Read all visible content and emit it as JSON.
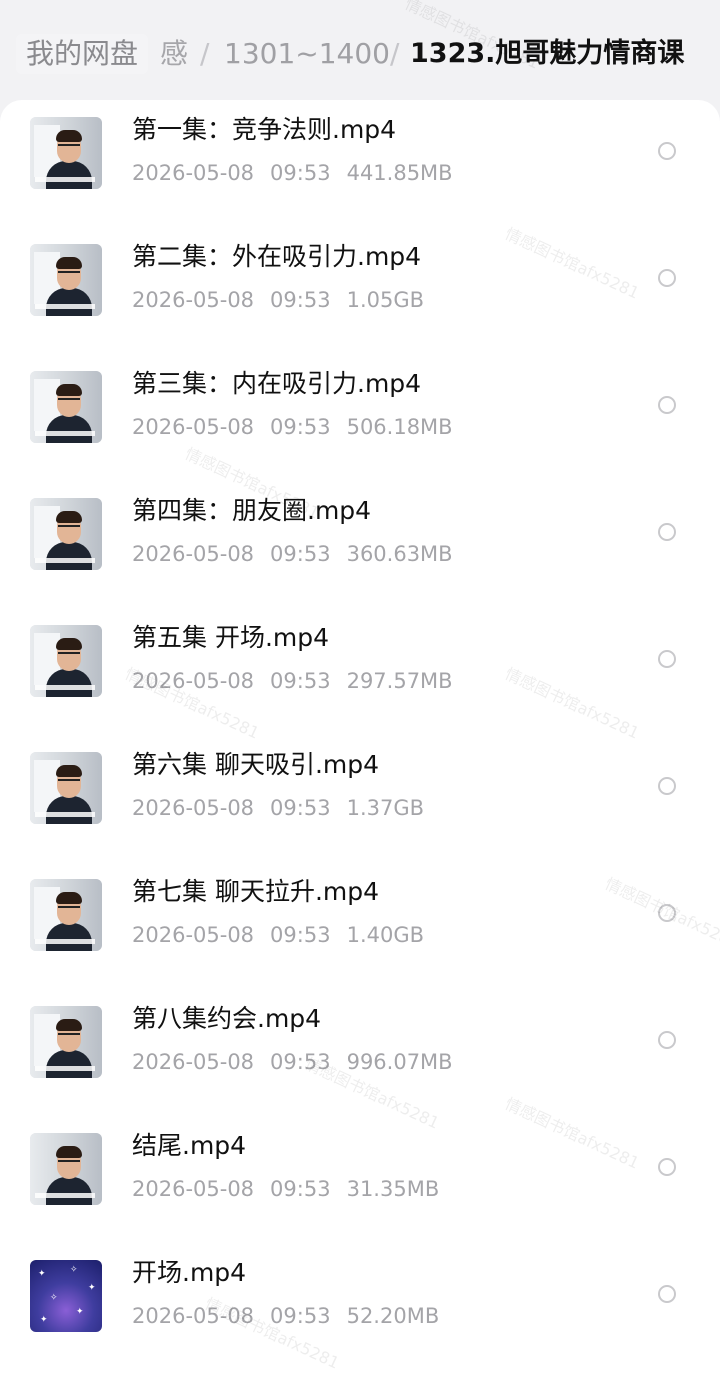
{
  "breadcrumb": {
    "root": "我的网盘",
    "mid_fragment": "感",
    "sep": "/",
    "folder": "1301~1400",
    "current": "1323.旭哥魅力情商课"
  },
  "files": [
    {
      "name": "第一集：竞争法则.mp4",
      "date": "2026-05-08",
      "time": "09:53",
      "size": "441.85MB",
      "thumb": "video-thumbnail"
    },
    {
      "name": "第二集：外在吸引力.mp4",
      "date": "2026-05-08",
      "time": "09:53",
      "size": "1.05GB",
      "thumb": "video-thumbnail"
    },
    {
      "name": "第三集：内在吸引力.mp4",
      "date": "2026-05-08",
      "time": "09:53",
      "size": "506.18MB",
      "thumb": "video-thumbnail"
    },
    {
      "name": "第四集：朋友圈.mp4",
      "date": "2026-05-08",
      "time": "09:53",
      "size": "360.63MB",
      "thumb": "video-thumbnail"
    },
    {
      "name": "第五集 开场.mp4",
      "date": "2026-05-08",
      "time": "09:53",
      "size": "297.57MB",
      "thumb": "video-thumbnail"
    },
    {
      "name": "第六集 聊天吸引.mp4",
      "date": "2026-05-08",
      "time": "09:53",
      "size": "1.37GB",
      "thumb": "video-thumbnail"
    },
    {
      "name": "第七集 聊天拉升.mp4",
      "date": "2026-05-08",
      "time": "09:53",
      "size": "1.40GB",
      "thumb": "video-thumbnail"
    },
    {
      "name": "第八集约会.mp4",
      "date": "2026-05-08",
      "time": "09:53",
      "size": "996.07MB",
      "thumb": "video-thumbnail"
    },
    {
      "name": "结尾.mp4",
      "date": "2026-05-08",
      "time": "09:53",
      "size": "31.35MB",
      "thumb": "video-thumbnail"
    },
    {
      "name": "开场.mp4",
      "date": "2026-05-08",
      "time": "09:53",
      "size": "52.20MB",
      "thumb": "space-thumbnail"
    }
  ],
  "watermark": "情感图书馆afx5281",
  "colors": {
    "background": "#f2f2f4",
    "list_bg": "#ffffff",
    "title_text": "#111111",
    "meta_text": "#a4a4a8",
    "radio_border": "#c9c9cc"
  }
}
